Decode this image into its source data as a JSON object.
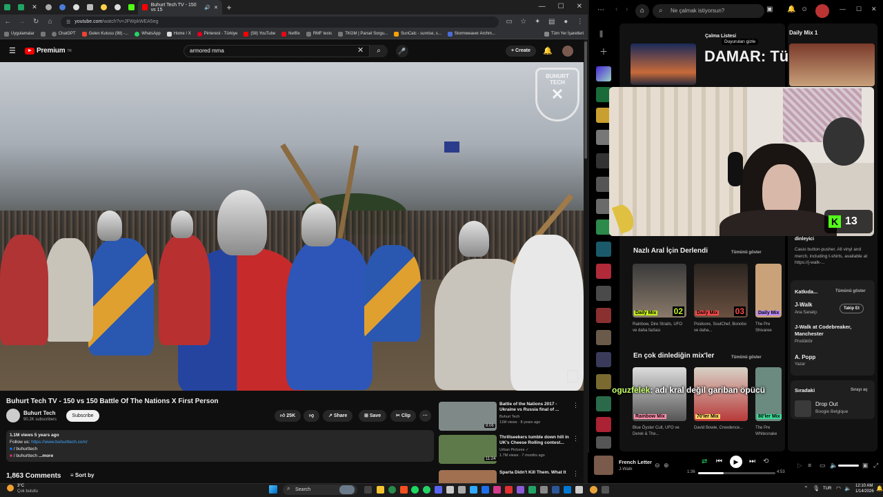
{
  "browser": {
    "active_tab_title": "Buhurt Tech TV - 150 vs 15",
    "url_host": "youtube.com",
    "url_path": "/watch?v=JFWpkWEA5eg",
    "bookmarks": [
      "Uygulamalar",
      "ChatGPT",
      "Gelen Kutusu (98) -...",
      "WhatsApp",
      "Home / X",
      "Pinterest - Türkiye",
      "(58) YouTube",
      "Netflix",
      "RMF tests",
      "TKGM | Parsel Sorgu...",
      "SunCalc - sunrise, s...",
      "Stormweaver Archm..."
    ],
    "bookmarks_right": "Tüm Yer İşaretleri"
  },
  "youtube": {
    "logo": "Premium",
    "logo_sup": "TR",
    "search_value": "armored mma",
    "create_label": "Create",
    "video_logo": "BUHURT TECH",
    "video_title": "Buhurt Tech TV - 150 vs 150 Battle Of The Nations X First Person",
    "channel": {
      "name": "Buhurt Tech",
      "subs": "90.2K subscribers",
      "subscribe": "Subscribe"
    },
    "actions": {
      "likes": "25K",
      "share": "Share",
      "save": "Save",
      "clip": "Clip",
      "more": "···"
    },
    "description": {
      "meta": "1.1M views  5 years ago",
      "follow_prefix": "Follow us: ",
      "follow_link": "https://www.buhurttech.com/",
      "fb": "/ buhurttech",
      "ig": "/ buhurttech",
      "more": "...more"
    },
    "comments_count": "1,863 Comments",
    "sort_by": "Sort by",
    "related": [
      {
        "title": "Battle of the Nations 2017 - Ukraine vs Russia final of ...",
        "channel": "Buhurt Tech",
        "meta": "11M views · 8 years ago",
        "duration": "8:06",
        "color": "#7f8a88"
      },
      {
        "title": "Thrillseekers tumble down hill in UK's Cheese Rolling contest...",
        "channel": "Urban Pictures",
        "meta": "1.7M views · 7 months ago",
        "duration": "11:24",
        "color": "#5f7a4a"
      },
      {
        "title": "Sparta Didn't Kill Them. What It",
        "channel": "",
        "meta": "",
        "duration": "",
        "color": "#a07050"
      }
    ]
  },
  "spotify": {
    "search_placeholder": "Ne çalmak istiyorsun?",
    "playlist_label": "Çalma Listesi",
    "hide_label": "Duyuruları gizle",
    "hero_title": "DAMAR: Türkçe...",
    "daily_mix_header": "Daily Mix 1",
    "section1": {
      "title": "Nazlı Aral İçin Derlendi",
      "see_all": "Tümünü göster"
    },
    "mixes1": [
      {
        "label": "Daily Mix",
        "num": "02",
        "artists": "Rainbow, Dire Straits, UFO ve daha fazlası",
        "color": "#7a6a5a",
        "lblcolor": "#c5f21e"
      },
      {
        "label": "Daily Mix",
        "num": "03",
        "artists": "Poidoore, SoulChef, Bonobo ve daha...",
        "color": "#4a3a30",
        "lblcolor": "#ff4b4b"
      },
      {
        "label": "Daily Mix",
        "num": "",
        "artists": "The Pre Shivaree",
        "color": "#c9a27a",
        "lblcolor": "#b98aff"
      }
    ],
    "section2": {
      "title": "En çok dinlediğin mix'ler",
      "see_all": "Tümünü göster"
    },
    "mixes2": [
      {
        "label": "Rainbow Mix",
        "artists": "Blue Öyster Cult, UFO ve Derek & The...",
        "color": "#6a6a6a",
        "lblcolor": "#ff8fab"
      },
      {
        "label": "70'ler Mix",
        "artists": "David Bowie, Creedence...",
        "color": "#c8c0b0",
        "lblcolor": "#ffd166"
      },
      {
        "label": "80'ler Mix",
        "artists": "The Pre Whitesnake",
        "color": "#6b8a80",
        "lblcolor": "#3ddc97"
      }
    ],
    "right": {
      "artist_snippet": "dinleyici",
      "bio": "Casio button-pusher. All vinyl and merch, including t-shirts, available at https://j-walk-...",
      "contrib_title": "Katkıda...",
      "contrib_see_all": "Tümünü göster",
      "contributors": [
        {
          "name": "J-Walk",
          "role": "Ana Sanatçı",
          "follow": "Takip Et"
        },
        {
          "name": "J-Walk at Codebreaker, Manchester",
          "role": "Prodüktör",
          "follow": ""
        },
        {
          "name": "A. Popp",
          "role": "Yazar",
          "follow": ""
        }
      ],
      "queue_title": "Sıradaki",
      "queue_link": "Sırayı aç",
      "queue_song": "Drop Out",
      "queue_artist": "Boogie Belgique"
    },
    "player": {
      "song": "French Letter",
      "artist": "J-Walk",
      "elapsed": "1:36",
      "total": "4:53",
      "progress": 0.33
    },
    "kick_count": "13",
    "chat_user": "oguzfelek",
    "chat_msg": ": adı kral değil gariban öpücü"
  },
  "taskbar": {
    "weather_temp": "3°C",
    "weather_desc": "Çok bulutlu",
    "search": "Search",
    "lang": "TUR",
    "time": "12:10 AM",
    "date": "1/14/2026"
  }
}
